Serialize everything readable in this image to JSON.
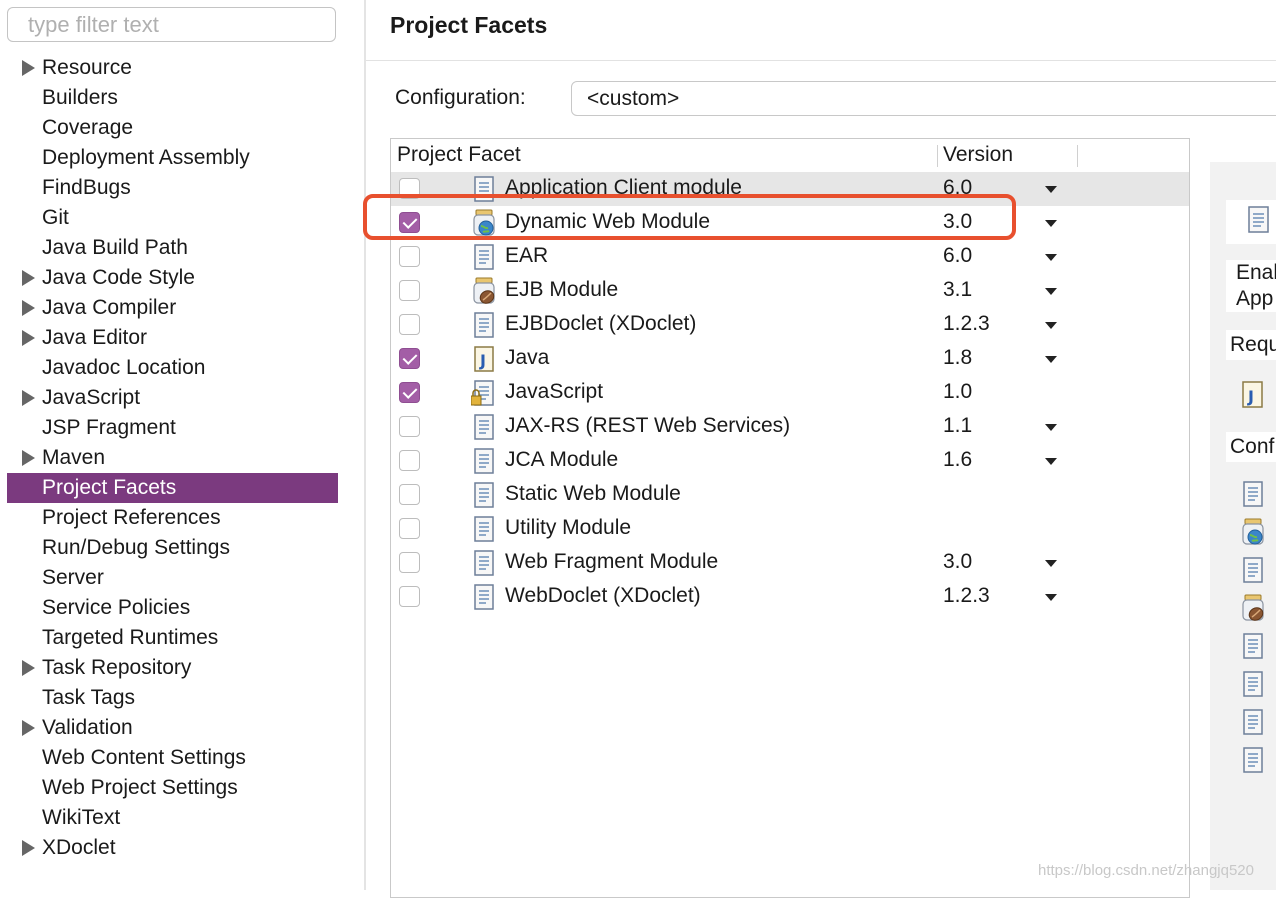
{
  "filter": {
    "placeholder": "type filter text"
  },
  "tree": [
    {
      "label": "Resource",
      "expandable": true
    },
    {
      "label": "Builders",
      "expandable": false
    },
    {
      "label": "Coverage",
      "expandable": false
    },
    {
      "label": "Deployment Assembly",
      "expandable": false
    },
    {
      "label": "FindBugs",
      "expandable": false
    },
    {
      "label": "Git",
      "expandable": false
    },
    {
      "label": "Java Build Path",
      "expandable": false
    },
    {
      "label": "Java Code Style",
      "expandable": true
    },
    {
      "label": "Java Compiler",
      "expandable": true
    },
    {
      "label": "Java Editor",
      "expandable": true
    },
    {
      "label": "Javadoc Location",
      "expandable": false
    },
    {
      "label": "JavaScript",
      "expandable": true
    },
    {
      "label": "JSP Fragment",
      "expandable": false
    },
    {
      "label": "Maven",
      "expandable": true
    },
    {
      "label": "Project Facets",
      "expandable": false,
      "selected": true
    },
    {
      "label": "Project References",
      "expandable": false
    },
    {
      "label": "Run/Debug Settings",
      "expandable": false
    },
    {
      "label": "Server",
      "expandable": false
    },
    {
      "label": "Service Policies",
      "expandable": false
    },
    {
      "label": "Targeted Runtimes",
      "expandable": false
    },
    {
      "label": "Task Repository",
      "expandable": true
    },
    {
      "label": "Task Tags",
      "expandable": false
    },
    {
      "label": "Validation",
      "expandable": true
    },
    {
      "label": "Web Content Settings",
      "expandable": false
    },
    {
      "label": "Web Project Settings",
      "expandable": false
    },
    {
      "label": "WikiText",
      "expandable": false
    },
    {
      "label": "XDoclet",
      "expandable": true
    }
  ],
  "main": {
    "title": "Project Facets",
    "config_label": "Configuration:",
    "config_value": "<custom>",
    "table": {
      "col_facet": "Project Facet",
      "col_version": "Version",
      "rows": [
        {
          "name": "Application Client module",
          "version": "6.0",
          "checked": false,
          "icon": "document-icon",
          "dropdown": true
        },
        {
          "name": "Dynamic Web Module",
          "version": "3.0",
          "checked": true,
          "icon": "web-module-globe-icon",
          "dropdown": true
        },
        {
          "name": "EAR",
          "version": "6.0",
          "checked": false,
          "icon": "document-icon",
          "dropdown": true
        },
        {
          "name": "EJB Module",
          "version": "3.1",
          "checked": false,
          "icon": "ejb-bean-jar-icon",
          "dropdown": true
        },
        {
          "name": "EJBDoclet (XDoclet)",
          "version": "1.2.3",
          "checked": false,
          "icon": "document-icon",
          "dropdown": true
        },
        {
          "name": "Java",
          "version": "1.8",
          "checked": true,
          "icon": "java-file-icon",
          "dropdown": true
        },
        {
          "name": "JavaScript",
          "version": "1.0",
          "checked": true,
          "icon": "locked-document-icon",
          "dropdown": false
        },
        {
          "name": "JAX-RS (REST Web Services)",
          "version": "1.1",
          "checked": false,
          "icon": "document-icon",
          "dropdown": true
        },
        {
          "name": "JCA Module",
          "version": "1.6",
          "checked": false,
          "icon": "document-icon",
          "dropdown": true
        },
        {
          "name": "Static Web Module",
          "version": "",
          "checked": false,
          "icon": "document-icon",
          "dropdown": false
        },
        {
          "name": "Utility Module",
          "version": "",
          "checked": false,
          "icon": "document-icon",
          "dropdown": false
        },
        {
          "name": "Web Fragment Module",
          "version": "3.0",
          "checked": false,
          "icon": "document-icon",
          "dropdown": true
        },
        {
          "name": "WebDoclet (XDoclet)",
          "version": "1.2.3",
          "checked": false,
          "icon": "document-icon",
          "dropdown": true
        }
      ]
    }
  },
  "details": {
    "enable_line1": "Enal",
    "enable_line2": "App",
    "requires": "Requ",
    "conflicts": "Conf"
  },
  "watermark": "https://blog.csdn.net/zhangjq520",
  "colors": {
    "selection": "#7b3a7f",
    "checkbox": "#a35ea6",
    "highlight": "#e8502e"
  }
}
